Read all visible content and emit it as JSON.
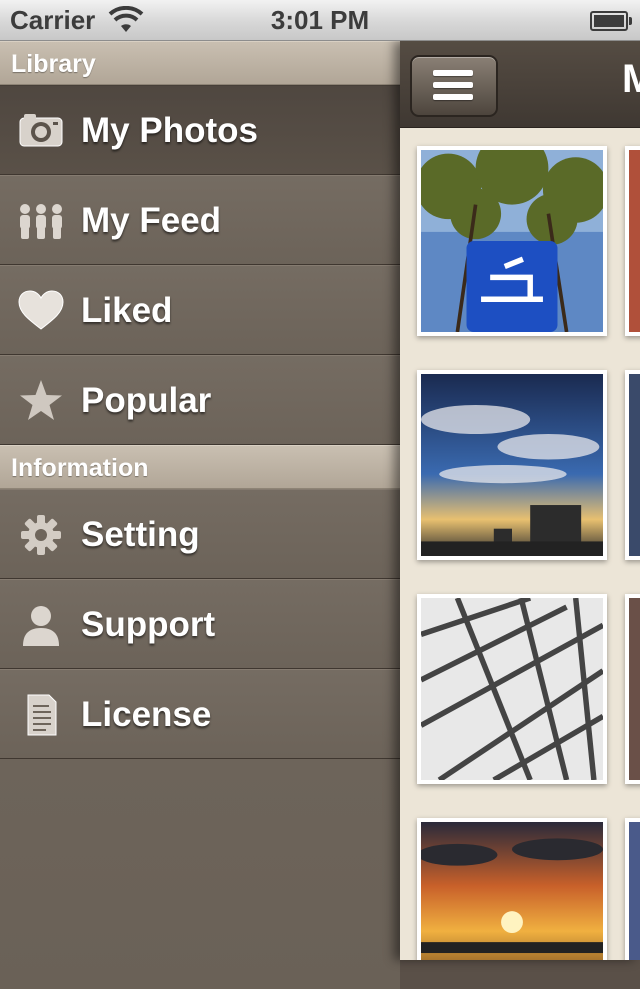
{
  "status_bar": {
    "carrier": "Carrier",
    "time": "3:01 PM",
    "wifi_icon": "wifi-icon",
    "battery_icon": "battery-icon"
  },
  "sidebar": {
    "sections": [
      {
        "title": "Library",
        "items": [
          {
            "label": "My Photos",
            "icon": "camera-icon",
            "selected": true
          },
          {
            "label": "My Feed",
            "icon": "people-icon",
            "selected": false
          },
          {
            "label": "Liked",
            "icon": "heart-icon",
            "selected": false
          },
          {
            "label": "Popular",
            "icon": "star-icon",
            "selected": false
          }
        ]
      },
      {
        "title": "Information",
        "items": [
          {
            "label": "Setting",
            "icon": "gear-icon",
            "selected": false
          },
          {
            "label": "Support",
            "icon": "person-icon",
            "selected": false
          },
          {
            "label": "License",
            "icon": "document-icon",
            "selected": false
          }
        ]
      }
    ]
  },
  "main": {
    "title": "M",
    "menu_button_icon": "hamburger-icon",
    "photos": [
      {
        "name": "photo-tree-sign"
      },
      {
        "name": "photo-sky-clouds"
      },
      {
        "name": "photo-steel-structure"
      },
      {
        "name": "photo-sunset"
      }
    ]
  },
  "colors": {
    "sidebar": "#6f665c",
    "section_header": "#bdb2a3",
    "main_background": "#ece5d7",
    "navbar": "#4a423a"
  }
}
